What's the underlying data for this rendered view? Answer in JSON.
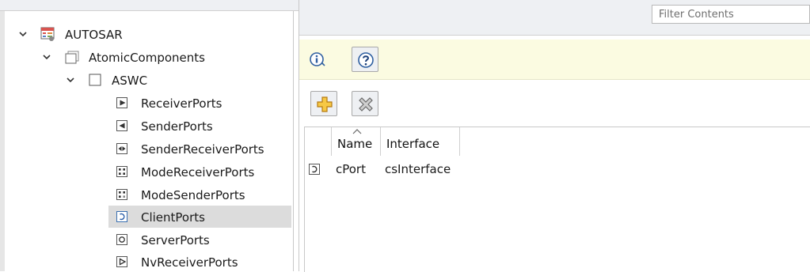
{
  "tree": {
    "root": {
      "label": "AUTOSAR",
      "icon": "autosar-package-icon"
    },
    "components": {
      "label": "AtomicComponents",
      "icon": "folder-icon"
    },
    "component": {
      "label": "ASWC",
      "icon": "component-icon"
    },
    "ports": [
      {
        "label": "ReceiverPorts",
        "icon": "receiver-port-icon"
      },
      {
        "label": "SenderPorts",
        "icon": "sender-port-icon"
      },
      {
        "label": "SenderReceiverPorts",
        "icon": "sender-receiver-port-icon"
      },
      {
        "label": "ModeReceiverPorts",
        "icon": "mode-receiver-port-icon"
      },
      {
        "label": "ModeSenderPorts",
        "icon": "mode-sender-port-icon"
      },
      {
        "label": "ClientPorts",
        "icon": "client-port-icon",
        "selected": true
      },
      {
        "label": "ServerPorts",
        "icon": "server-port-icon"
      },
      {
        "label": "NvReceiverPorts",
        "icon": "nv-receiver-port-icon"
      }
    ]
  },
  "filter": {
    "placeholder": "Filter Contents"
  },
  "infobar": {
    "icons": [
      "info-icon",
      "help-icon"
    ]
  },
  "toolbar": {
    "icons": [
      "add-icon",
      "delete-icon"
    ]
  },
  "table": {
    "columns": [
      "Name",
      "Interface"
    ],
    "sorted_column": "Name",
    "rows": [
      {
        "icon": "client-port-icon",
        "name": "cPort",
        "interface": "csInterface"
      }
    ]
  }
}
